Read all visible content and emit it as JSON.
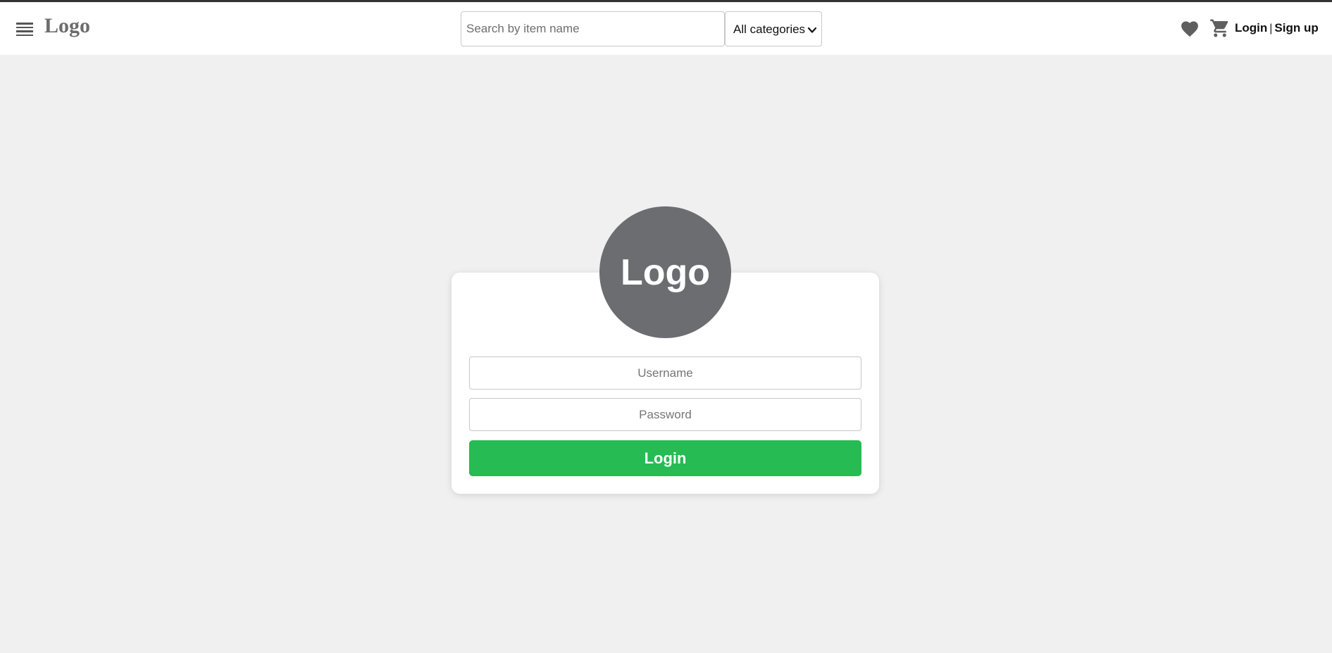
{
  "header": {
    "logo_text": "Logo",
    "search": {
      "placeholder": "Search by item name",
      "value": ""
    },
    "category_select": {
      "selected": "All categories"
    },
    "auth": {
      "login_label": "Login",
      "separator": "|",
      "signup_label": "Sign up"
    }
  },
  "login_card": {
    "badge_text": "Logo",
    "username": {
      "placeholder": "Username",
      "value": ""
    },
    "password": {
      "placeholder": "Password",
      "value": ""
    },
    "submit_label": "Login"
  },
  "icons": {
    "menu": "hamburger-menu-icon",
    "favorites": "heart-icon",
    "cart": "shopping-cart-icon",
    "dropdown": "chevron-down-icon"
  },
  "colors": {
    "background": "#f0f0f0",
    "header": "#ffffff",
    "badge": "#6b6d71",
    "primary_button": "#26bb53",
    "icon": "#5f5f5f"
  }
}
